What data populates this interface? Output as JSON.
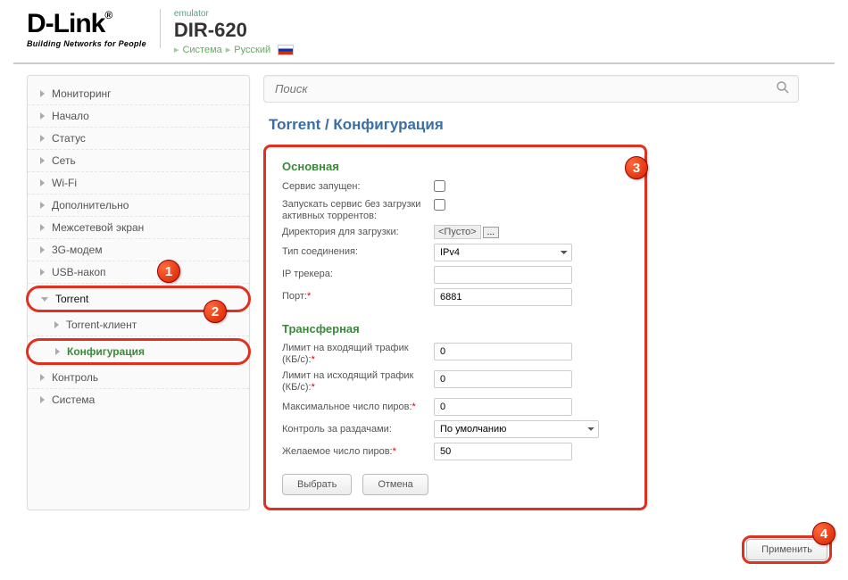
{
  "header": {
    "brand_name": "D-Link",
    "brand_reg": "®",
    "brand_tagline": "Building Networks for People",
    "emulator_label": "emulator",
    "model": "DIR-620",
    "crumb_system": "Система",
    "crumb_lang": "Русский"
  },
  "nav": {
    "monitoring": "Мониторинг",
    "start": "Начало",
    "status": "Статус",
    "network": "Сеть",
    "wifi": "Wi-Fi",
    "advanced": "Дополнительно",
    "firewall": "Межсетевой экран",
    "modem3g": "3G-модем",
    "usb": "USB-накоп",
    "torrent": "Torrent",
    "torrent_client": "Torrent-клиент",
    "torrent_conf": "Конфигурация",
    "control": "Контроль",
    "system": "Система"
  },
  "search": {
    "placeholder": "Поиск"
  },
  "page": {
    "title": "Torrent /  Конфигурация",
    "section_main": "Основная",
    "section_transfer": "Трансферная",
    "lbl_service_running": "Сервис запущен:",
    "lbl_start_noactive": "Запускать сервис без загрузки активных торрентов:",
    "lbl_download_dir": "Директория для загрузки:",
    "dir_value": "<Пусто>",
    "dir_browse": "...",
    "lbl_conn_type": "Тип соединения:",
    "val_conn_type": "IPv4",
    "lbl_tracker_ip": "IP трекера:",
    "val_tracker_ip": "",
    "lbl_port": "Порт:",
    "val_port": "6881",
    "lbl_limit_in": "Лимит на входящий трафик (КБ/с):",
    "val_limit_in": "0",
    "lbl_limit_out": "Лимит на исходящий трафик (КБ/с):",
    "val_limit_out": "0",
    "lbl_max_peers": "Максимальное число пиров:",
    "val_max_peers": "0",
    "lbl_seed_ctrl": "Контроль за раздачами:",
    "val_seed_ctrl": "По умолчанию",
    "lbl_desired_peers": "Желаемое число пиров:",
    "val_desired_peers": "50",
    "btn_select": "Выбрать",
    "btn_cancel": "Отмена",
    "btn_apply": "Применить"
  },
  "badges": {
    "b1": "1",
    "b2": "2",
    "b3": "3",
    "b4": "4"
  }
}
